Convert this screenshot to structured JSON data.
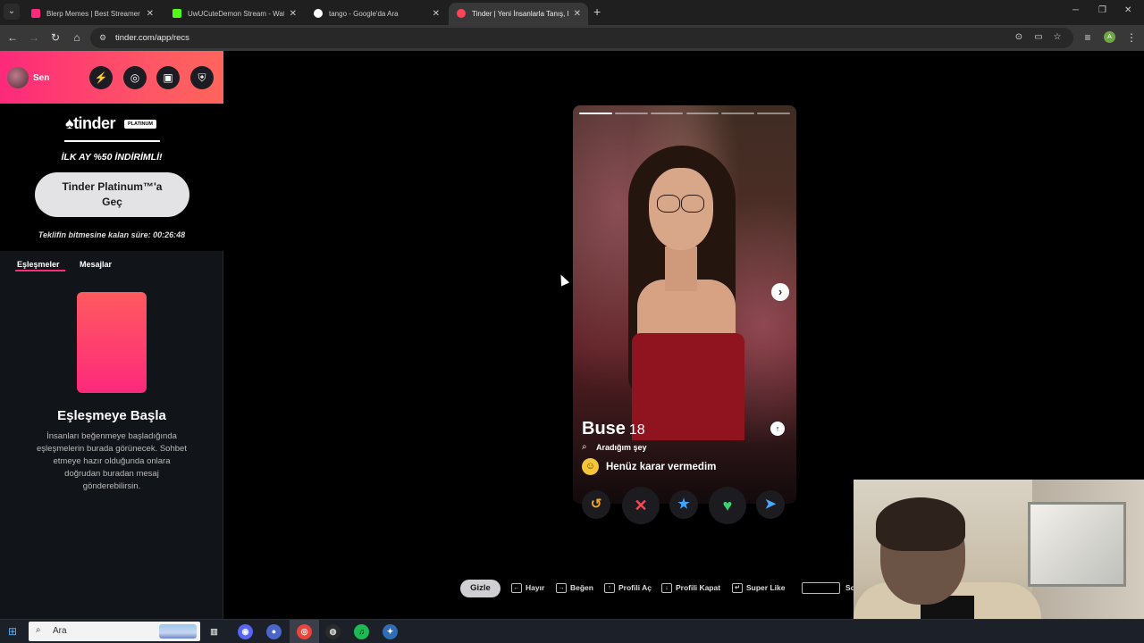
{
  "browser": {
    "tabs": [
      {
        "label": "Blerp Memes | Best Streamer So",
        "color": "#fd297b"
      },
      {
        "label": "UwUCuteDemon Stream - Watc",
        "color": "#53fc18"
      },
      {
        "label": "tango - Google'da Ara",
        "color": "#4285f4"
      },
      {
        "label": "Tinder | Yeni İnsanlarla Tanış, Bu",
        "color": "#ff4458",
        "active": true
      }
    ],
    "url": "tinder.com/app/recs",
    "profile_initial": "A"
  },
  "sidebar": {
    "user_name": "Sen",
    "logo": "tinder",
    "logo_badge": "PLATINUM",
    "offer": "İLK AY %50 İNDİRİMLİ!",
    "upgrade_label_line1": "Tinder Platinum™'a",
    "upgrade_label_line2": "Geç",
    "timer": "Teklifin bitmesine kalan süre: 00:26:48",
    "tabs": [
      "Eşleşmeler",
      "Mesajlar"
    ],
    "empty_title": "Eşleşmeye Başla",
    "empty_text": "İnsanları beğenmeye başladığında eşleşmelerin burada görünecek. Sohbet etmeye hazır olduğunda onlara doğrudan buradan mesaj gönderebilirsin."
  },
  "profile": {
    "name": "Buse",
    "age": "18",
    "looking_label": "Aradığım şey",
    "status": "Henüz karar vermedim",
    "photo_count": 6,
    "current_photo": 1
  },
  "hints": {
    "gizle": "Gizle",
    "items": [
      "Hayır",
      "Beğen",
      "Profili Aç",
      "Profili Kapat",
      "Super Like"
    ],
    "cut_off": "So"
  },
  "taskbar": {
    "search_placeholder": "Ara"
  },
  "colors": {
    "brand": "#fd297b",
    "rewind": "#f5a623",
    "nope": "#ff4458",
    "superlike": "#3ca4ff",
    "like": "#3bd16f",
    "boost": "#4aa8ff"
  }
}
